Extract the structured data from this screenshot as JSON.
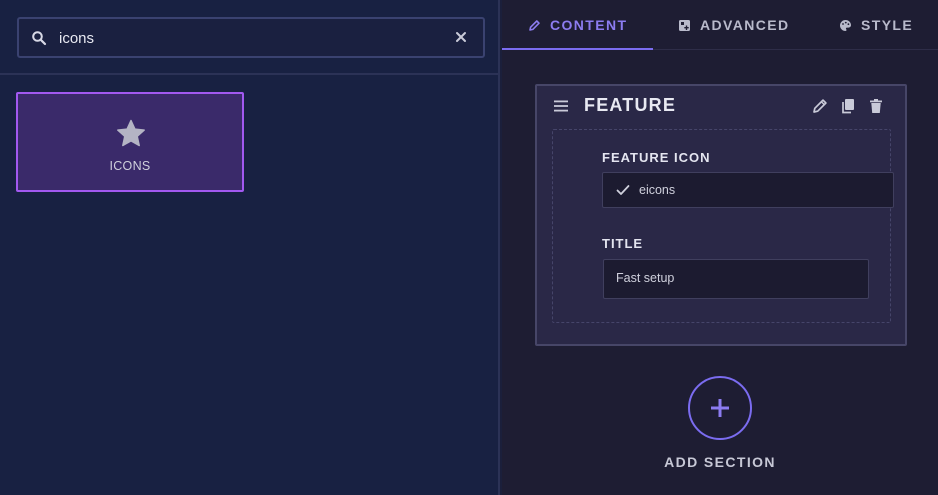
{
  "search": {
    "value": "icons",
    "placeholder": ""
  },
  "widgets": [
    {
      "label": "ICONS",
      "icon": "star-icon"
    }
  ],
  "tabs": [
    {
      "label": "CONTENT",
      "icon": "pencil-icon",
      "active": true
    },
    {
      "label": "ADVANCED",
      "icon": "grid-plus-icon",
      "active": false
    },
    {
      "label": "STYLE",
      "icon": "palette-icon",
      "active": false
    }
  ],
  "section": {
    "title": "FEATURE",
    "fields": {
      "icon_label": "FEATURE ICON",
      "icon_value": "eicons",
      "title_label": "TITLE",
      "title_value": "Fast setup"
    }
  },
  "add_section_label": "ADD SECTION",
  "colors": {
    "accent": "#7b6cf0",
    "widget_border": "#a259f0",
    "left_bg": "#182142",
    "right_bg": "#1e1d33"
  }
}
